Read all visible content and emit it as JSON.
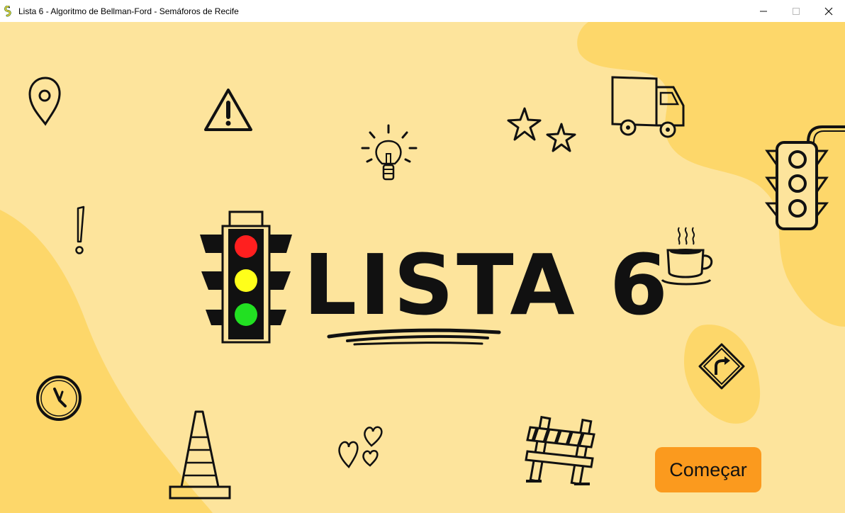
{
  "window": {
    "title": "Lista 6 - Algoritmo de Bellman-Ford - Semáforos de Recife",
    "app_icon": "pygame-snake-icon",
    "controls": [
      "minimize-icon",
      "maximize-icon",
      "close-icon"
    ]
  },
  "screen": {
    "heading": "LISTA 6",
    "start_button_label": "Começar",
    "background_color": "#fde49c",
    "blob_color": "#fdd76a",
    "button_color": "#fb9a1e",
    "traffic_light_colors": {
      "red": "#ff1f1f",
      "yellow": "#ffff1a",
      "green": "#22e022"
    }
  },
  "doodles": [
    "location-pin-icon",
    "warning-triangle-icon",
    "light-bulb-icon",
    "stars-icon",
    "delivery-truck-icon",
    "hanging-traffic-light-icon",
    "exclamation-icon",
    "coffee-cup-icon",
    "road-sign-icon",
    "compass-icon",
    "traffic-cone-icon",
    "hearts-icon",
    "road-barrier-icon"
  ]
}
